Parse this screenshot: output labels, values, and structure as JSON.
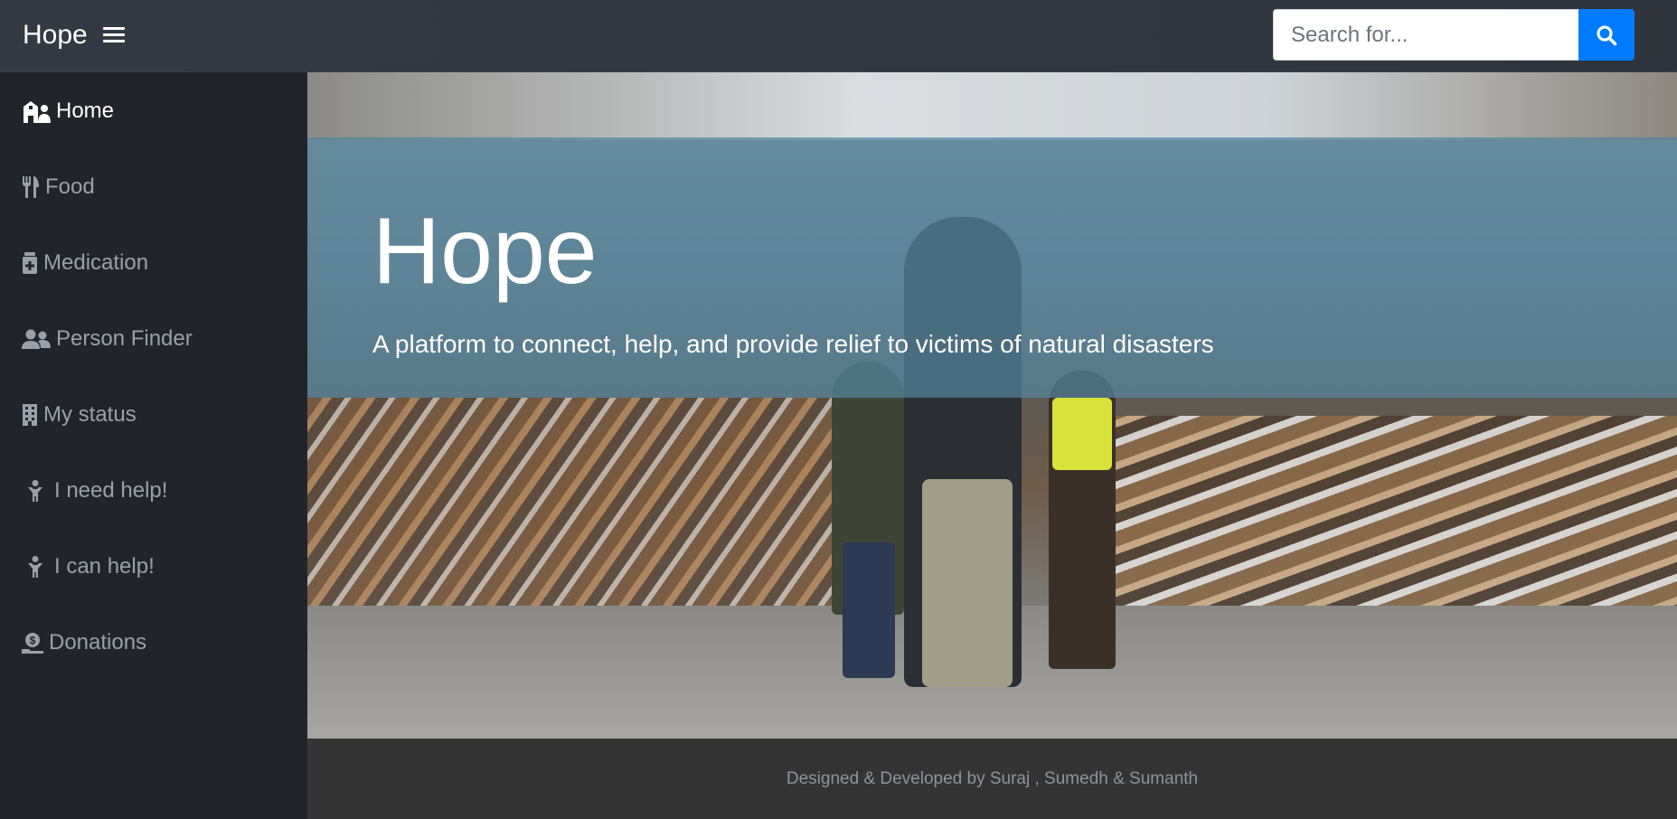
{
  "header": {
    "brand": "Hope"
  },
  "search": {
    "placeholder": "Search for..."
  },
  "sidebar": {
    "items": [
      {
        "label": "Home",
        "icon": "hospital-user-icon",
        "active": true
      },
      {
        "label": "Food",
        "icon": "utensils-icon",
        "active": false
      },
      {
        "label": "Medication",
        "icon": "medkit-icon",
        "active": false
      },
      {
        "label": "Person Finder",
        "icon": "user-friends-icon",
        "active": false
      },
      {
        "label": "My status",
        "icon": "building-icon",
        "active": false
      },
      {
        "label": "I need help!",
        "icon": "child-icon",
        "active": false
      },
      {
        "label": "I can help!",
        "icon": "child-icon",
        "active": false
      },
      {
        "label": "Donations",
        "icon": "hand-holding-usd-icon",
        "active": false
      }
    ]
  },
  "hero": {
    "title": "Hope",
    "subtitle": "A platform to connect, help, and provide relief to victims of natural disasters"
  },
  "footer": {
    "text": "Designed & Developed by Suraj , Sumedh & Sumanth"
  },
  "colors": {
    "accent": "#007bff",
    "sidebar": "#21242b",
    "topbar": "#343a44",
    "footer": "#343434",
    "overlay": "#54849c"
  }
}
